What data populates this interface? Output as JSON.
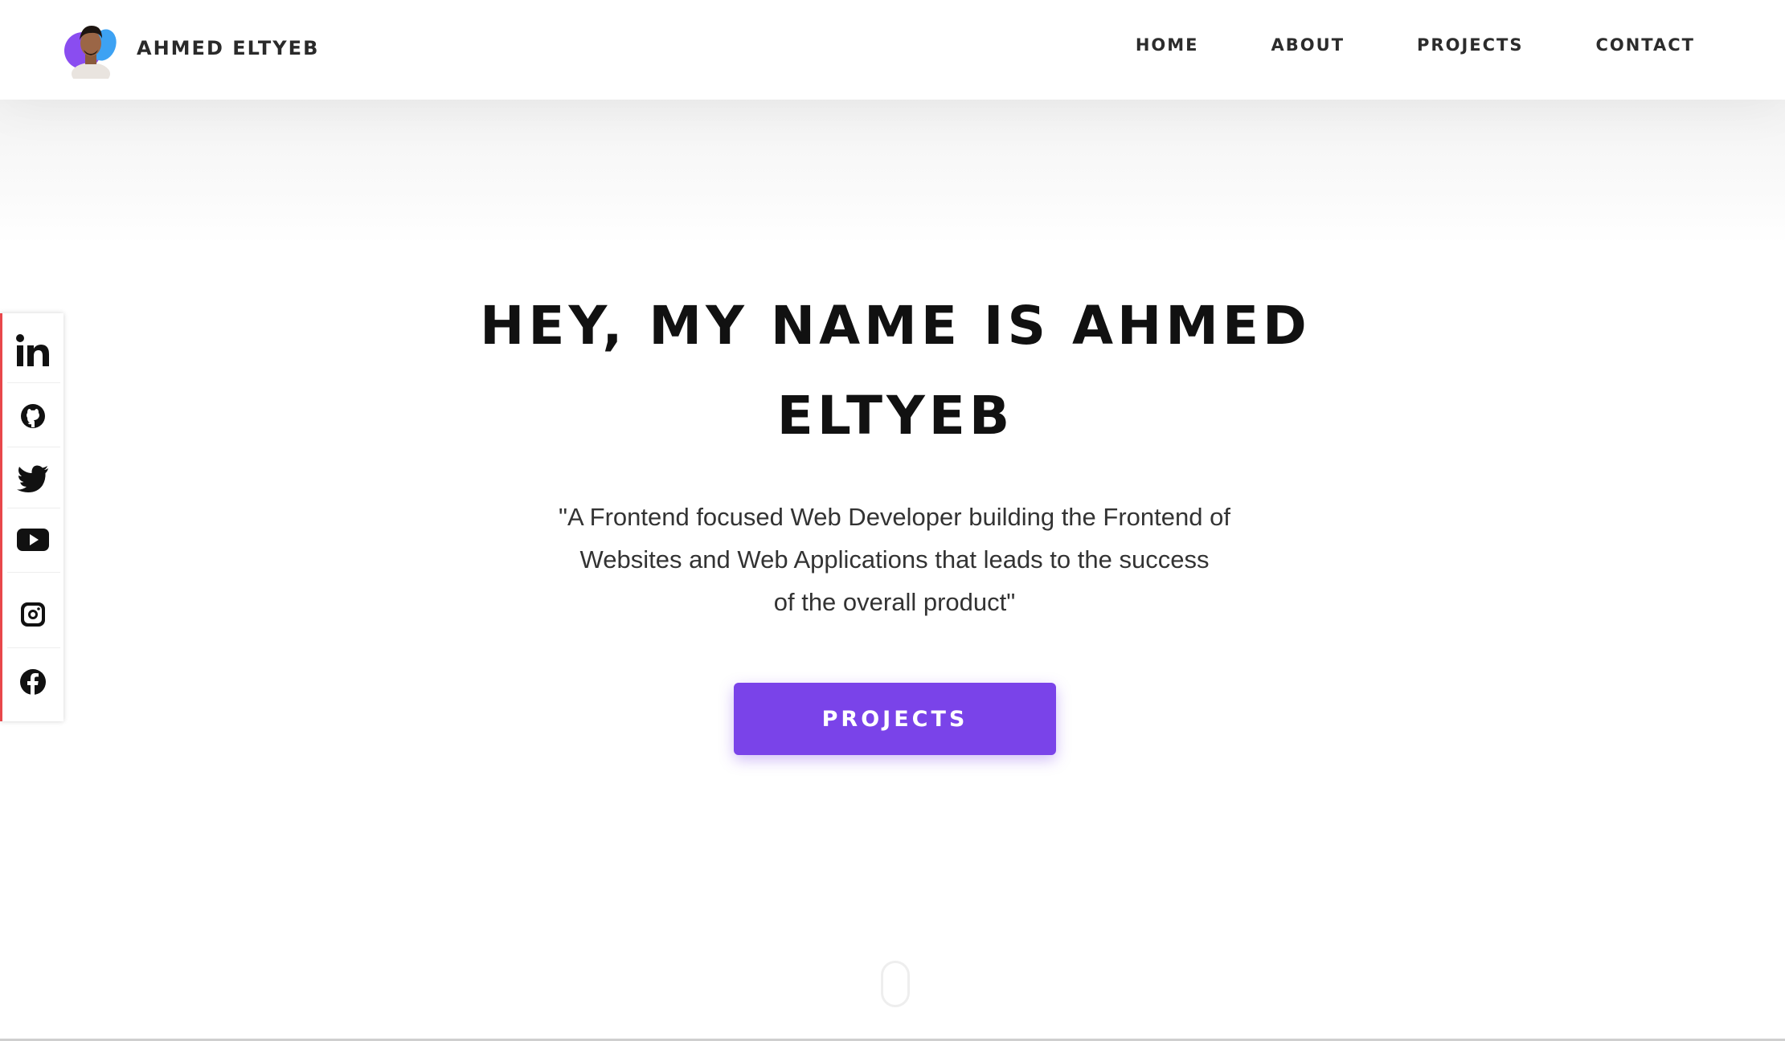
{
  "header": {
    "brand_name": "AHMED ELTYEB",
    "nav": [
      {
        "label": "HOME"
      },
      {
        "label": "ABOUT"
      },
      {
        "label": "PROJECTS"
      },
      {
        "label": "CONTACT"
      }
    ]
  },
  "social": {
    "items": [
      {
        "icon": "linkedin-icon"
      },
      {
        "icon": "github-icon"
      },
      {
        "icon": "twitter-icon"
      },
      {
        "icon": "youtube-icon"
      },
      {
        "icon": "instagram-icon"
      },
      {
        "icon": "facebook-icon"
      }
    ],
    "accent_color": "#e8474b"
  },
  "hero": {
    "title_line1": "HEY, MY NAME IS AHMED",
    "title_line2": "ELTYEB",
    "subtitle_line1": "\"A Frontend focused Web Developer building the Frontend of",
    "subtitle_line2": "Websites and Web Applications that leads to the success",
    "subtitle_line3": "of the overall product\"",
    "cta_label": "PROJECTS",
    "cta_color": "#7a43e9"
  }
}
